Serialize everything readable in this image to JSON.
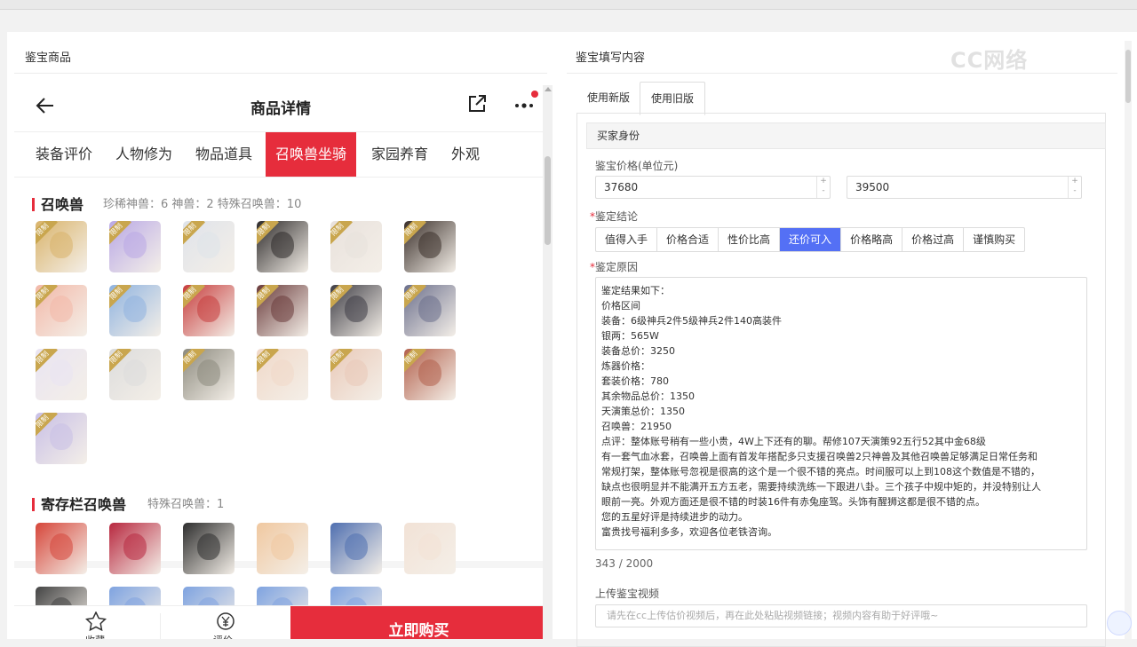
{
  "left_panel": {
    "title": "鉴宝商品"
  },
  "right_panel": {
    "title": "鉴宝填写内容"
  },
  "phone": {
    "nav_title": "商品详情",
    "tabs": [
      {
        "label": "装备评价",
        "active": false
      },
      {
        "label": "人物修为",
        "active": false
      },
      {
        "label": "物品道具",
        "active": false
      },
      {
        "label": "召唤兽坐骑",
        "active": true
      },
      {
        "label": "家园养育",
        "active": false
      },
      {
        "label": "外观",
        "active": false
      }
    ],
    "summon_section": {
      "title": "召唤兽",
      "stats": "珍稀神兽：6   神兽：2   特殊召唤兽：10",
      "avatar_tag": "限制",
      "avatars": [
        "#d9b36a",
        "#b9a8e6",
        "#dfe3ea",
        "#2d2a2a",
        "#e8e1dc",
        "#3a2f2a",
        "#f2b8a8",
        "#8fb3e0",
        "#c73d3d",
        "#6a3b3b",
        "#3e3d45",
        "#6b6f8c",
        "#e9e4f2",
        "#dcdcdc",
        "#8c8a7e",
        "#f0d8c8",
        "#e9c9b8",
        "#b3614d",
        "#c8bfe6"
      ]
    },
    "storage_section": {
      "title": "寄存栏召唤兽",
      "stats": "特殊召唤兽：1",
      "avatars": [
        "#d6463a",
        "#b8283f",
        "#2e2e2e",
        "#f0c8a0",
        "#4f6fb0",
        "#f2e2d6",
        "#444",
        "#7fa3e0",
        "#7fa3e0",
        "#7fa3e0",
        "#7fa3e0"
      ]
    },
    "bottom": {
      "fav_label": "收藏",
      "eval_label": "评价",
      "buy_label": "立即购买"
    }
  },
  "form": {
    "tabs": [
      {
        "label": "使用新版",
        "active": false
      },
      {
        "label": "使用旧版",
        "active": true
      }
    ],
    "section_title": "买家身份",
    "price_label": "鉴宝价格(单位元)",
    "price_low": "37680",
    "price_high": "39500",
    "conclusion_label": "鉴定结论",
    "conclusion_options": [
      {
        "label": "值得入手",
        "active": false
      },
      {
        "label": "价格合适",
        "active": false
      },
      {
        "label": "性价比高",
        "active": false
      },
      {
        "label": "还价可入",
        "active": true
      },
      {
        "label": "价格略高",
        "active": false
      },
      {
        "label": "价格过高",
        "active": false
      },
      {
        "label": "谨慎购买",
        "active": false
      }
    ],
    "reason_label": "鉴定原因",
    "reason_lines": [
      "鉴定结果如下：",
      "价格区间",
      "装备：6级神兵2件5级神兵2件140高装件",
      "银两：565W",
      "装备总价：3250",
      "炼器价格：",
      "套装价格：780",
      "其余物品总价：1350",
      "天演策总价：1350",
      "召唤兽：21950",
      "点评：整体账号稍有一些小贵，4W上下还有的聊。帮修107天演策92五行52其中金68级",
      "有一套气血冰套，召唤兽上面有首发年搭配多只支援召唤兽2只神兽及其他召唤兽足够满足日常任务和",
      "常规打架，整体账号忽视是很高的这个是一个很不错的亮点。时间服可以上到108这个数值是不错的，",
      "缺点也很明显并不能满开五方五老，需要持续洗练一下跟进八卦。三个孩子中规中矩的，并没特别让人",
      "眼前一亮。外观方面还是很不错的时装16件有赤兔座驾。头饰有醒狮这都是很不错的点。",
      " 您的五星好评是持续进步的动力。",
      "富贵找号福利多多，欢迎各位老铁咨询。"
    ],
    "char_count": "343 / 2000",
    "video_label": "上传鉴宝视频",
    "video_placeholder": "请先在cc上传估价视频后，再在此处粘贴视频链接；视频内容有助于好评哦~"
  },
  "watermark": "CC网络",
  "accent_color": "#e62d3c",
  "selected_color": "#5470f5"
}
